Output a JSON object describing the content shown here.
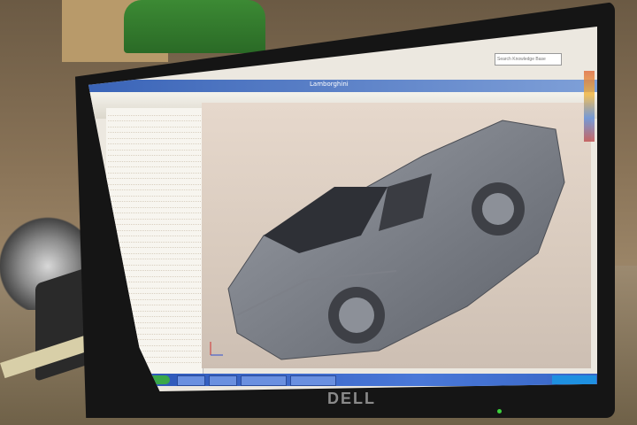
{
  "window": {
    "title": "Lamborghini"
  },
  "search": {
    "placeholder": "Search Knowledge Base"
  },
  "feature_tree": {
    "items": [
      "",
      "",
      "",
      "",
      "",
      "",
      "",
      "",
      "",
      "",
      "",
      "",
      "",
      "",
      "",
      "",
      "",
      "",
      "",
      "",
      "",
      "",
      "",
      "",
      "",
      "",
      "",
      "",
      "",
      "",
      "",
      "",
      "",
      "",
      "",
      "",
      "",
      "",
      "",
      "",
      "",
      "",
      "",
      ""
    ]
  },
  "taskbar": {
    "items": [
      "",
      "",
      "",
      ""
    ],
    "clock": ""
  },
  "laptop": {
    "brand": "DELL"
  }
}
